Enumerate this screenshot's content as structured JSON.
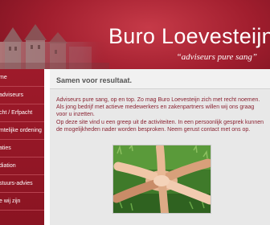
{
  "header": {
    "title": "Buro Loevesteijn",
    "tagline": "“adviseurs pure sang”"
  },
  "nav": {
    "items": [
      {
        "label": "me"
      },
      {
        "label": "adviseurs"
      },
      {
        "label": "cht / Erfpacht"
      },
      {
        "label": "mtelijke ordening"
      },
      {
        "label": "aties"
      },
      {
        "label": "diation"
      },
      {
        "label": "stuurs-advies"
      },
      {
        "label": "e wij zijn"
      }
    ]
  },
  "main": {
    "heading": "Samen voor resultaat.",
    "paragraph1": "Adviseurs pure sang, op en top. Zo mag Buro Loevesteijn zich met recht noemen. Als jong bedrijf met actieve medewerkers en zakenpartners willen wij ons graag voor u inzetten.",
    "paragraph2": "Op deze site vind u een greep uit de activiteiten. In een persoonlijk gesprek kunnen de mogelijkheden nader worden besproken. Neem gerust contact met ons op."
  },
  "colors": {
    "brand": "#a11e2e",
    "text_accent": "#8a2231"
  }
}
